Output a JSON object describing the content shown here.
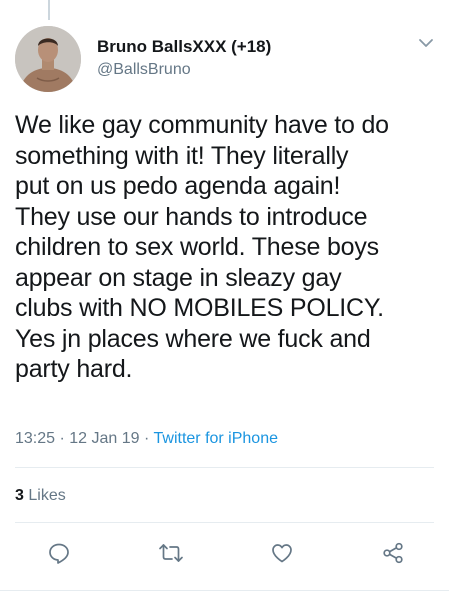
{
  "tweet": {
    "display_name": "Bruno BallsXXX (+18)",
    "handle": "@BallsBruno",
    "text_lines": [
      "We like gay community have to do",
      "something with it! They literally",
      "put on us pedo agenda again!",
      "They use our hands to introduce",
      "children to sex world. These boys",
      "appear on stage in sleazy gay",
      "clubs with NO MOBILES POLICY.",
      "Yes jn places where we fuck and",
      "party hard."
    ],
    "time": "13:25",
    "date": "12 Jan 19",
    "separator": "·",
    "source": "Twitter for iPhone",
    "likes_count": "3",
    "likes_label": "Likes"
  },
  "icons": {
    "avatar": "avatar",
    "menu": "chevron-down-icon",
    "reply": "reply-icon",
    "retweet": "retweet-icon",
    "like": "heart-icon",
    "share": "share-icon"
  },
  "colors": {
    "text": "#14171a",
    "secondary": "#657786",
    "link": "#1b95e0",
    "divider": "#e6ecf0",
    "icon": "#657786"
  }
}
